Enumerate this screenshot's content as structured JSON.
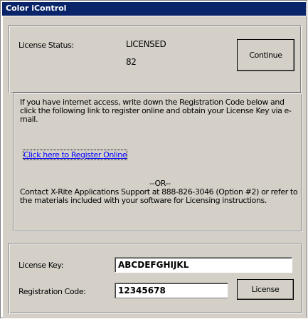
{
  "window": {
    "title": "Color iControl"
  },
  "status": {
    "label": "License Status:",
    "value": "LICENSED",
    "number": "82",
    "continue_label": "Continue"
  },
  "info": {
    "paragraph": "If you have internet access, write down the Registration Code below and click the following link to register online and obtain your License Key via e-mail.",
    "link_text": "Click here to Register Online",
    "or_text": "--OR--",
    "contact_text": "Contact X-Rite Applications Support at 888-826-3046 (Option #2) or refer to the materials included with your software for Licensing instructions."
  },
  "license": {
    "key_label": "License Key:",
    "key_value": "ABCDEFGHIJKL",
    "reg_label": "Registration Code:",
    "reg_value": "12345678",
    "license_button_label": "License"
  }
}
